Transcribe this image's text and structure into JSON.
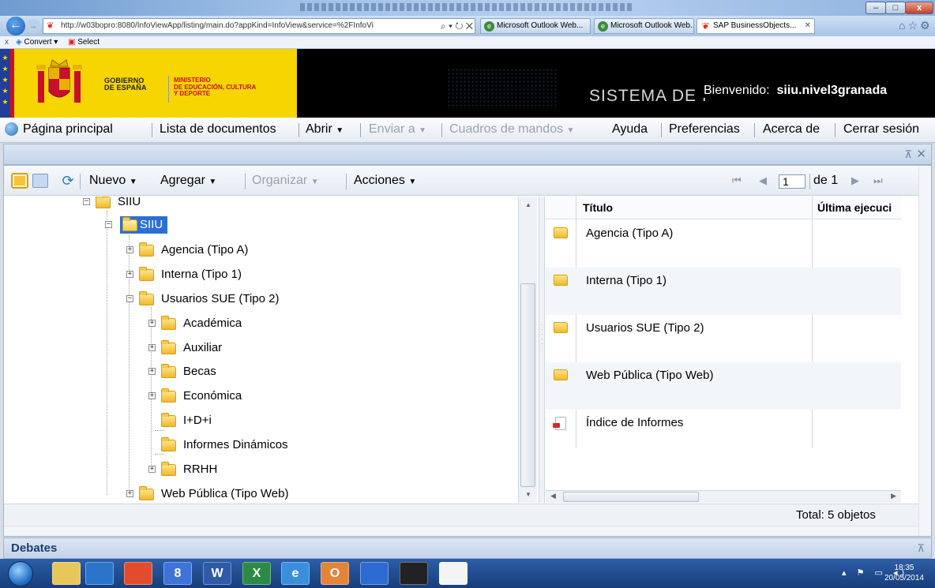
{
  "browser": {
    "url": "http://w03bopro:8080/InfoViewApp/listing/main.do?appKind=InfoView&service=%2FInfoVi",
    "address_controls": "⌕ ▾ ↻ ✕",
    "tabs": [
      {
        "label": "Microsoft Outlook Web..."
      },
      {
        "label": "Microsoft Outlook Web..."
      },
      {
        "label": "SAP BusinessObjects..."
      }
    ],
    "command_bar": {
      "close": "x",
      "convert": "Convert",
      "select": "Select"
    }
  },
  "banner": {
    "gobierno": "GOBIERNO\nDE ESPAÑA",
    "ministerio": "MINISTERIO\nDE EDUCACIÓN, CULTURA\nY DEPORTE",
    "system_title": "SISTEMA DE I",
    "welcome_label": "Bienvenido:",
    "username": "siiu.nivel3granada"
  },
  "main_menu": {
    "items": [
      {
        "label": "Página principal",
        "enabled": true
      },
      {
        "label": "Lista de documentos",
        "enabled": true
      },
      {
        "label": "Abrir",
        "enabled": true
      },
      {
        "label": "Enviar a",
        "enabled": false
      },
      {
        "label": "Cuadros de mandos",
        "enabled": false
      },
      {
        "label": "Ayuda",
        "enabled": true
      },
      {
        "label": "Preferencias",
        "enabled": true
      },
      {
        "label": "Acerca de",
        "enabled": true
      },
      {
        "label": "Cerrar sesión",
        "enabled": true
      }
    ]
  },
  "toolbar": {
    "nuevo": "Nuevo",
    "agregar": "Agregar",
    "organizar": "Organizar",
    "acciones": "Acciones",
    "page_value": "1",
    "page_of": "de 1"
  },
  "tree": {
    "root": "SIIU",
    "selected": "SIIU",
    "nodes": [
      {
        "label": "Agencia (Tipo A)"
      },
      {
        "label": "Interna (Tipo 1)"
      },
      {
        "label": "Usuarios SUE (Tipo 2)"
      },
      {
        "label": "Académica"
      },
      {
        "label": "Auxiliar"
      },
      {
        "label": "Becas"
      },
      {
        "label": "Económica"
      },
      {
        "label": "I+D+i"
      },
      {
        "label": "Informes Dinámicos"
      },
      {
        "label": "RRHH"
      },
      {
        "label": "Web Pública (Tipo Web)"
      }
    ]
  },
  "list": {
    "columns": [
      "Título",
      "Última ejecuci"
    ],
    "rows": [
      {
        "title": "Agencia (Tipo A)",
        "type": "folder"
      },
      {
        "title": "Interna (Tipo 1)",
        "type": "folder"
      },
      {
        "title": "Usuarios SUE (Tipo 2)",
        "type": "folder"
      },
      {
        "title": "Web Pública (Tipo Web)",
        "type": "folder"
      },
      {
        "title": "Índice de Informes",
        "type": "report"
      }
    ]
  },
  "status": {
    "total": "Total: 5 objetos"
  },
  "debates": {
    "title": "Debates"
  },
  "taskbar": {
    "apps": [
      "",
      "",
      "",
      "8",
      "W",
      "X",
      "e",
      "O",
      "",
      "",
      ""
    ],
    "time": "18:35",
    "date": "20/05/2014"
  }
}
